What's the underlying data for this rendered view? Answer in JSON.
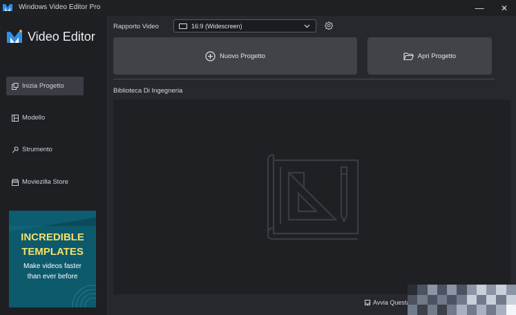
{
  "window": {
    "title": "Windows Video Editor Pro",
    "minimize_glyph": "—",
    "close_glyph": "✕"
  },
  "brand": {
    "name": "Video Editor",
    "logo_icon": "moviezilla-m-logo",
    "accent": "#2f8fe8"
  },
  "sidebar": {
    "items": [
      {
        "label": "Inizia Progetto",
        "icon": "new-project-icon",
        "active": true
      },
      {
        "label": "Modello",
        "icon": "template-icon",
        "active": false
      },
      {
        "label": "Strumento",
        "icon": "tool-icon",
        "active": false
      },
      {
        "label": "Moviezilla Store",
        "icon": "store-icon",
        "active": false
      }
    ]
  },
  "promo": {
    "headline_line1": "INCREDIBLE",
    "headline_line2": "TEMPLATES",
    "sub_line1": "Make videos faster",
    "sub_line2": "than ever before",
    "bg": "#0d5a6d",
    "headline_color": "#f3e06a"
  },
  "toolbar": {
    "ratio_label": "Rapporto Video",
    "ratio_value": "16:9 (Widescreen)"
  },
  "actions": {
    "new_project": "Nuovo Progetto",
    "open_project": "Apri Progetto"
  },
  "library": {
    "label": "Biblioteca Di Ingegneria"
  },
  "footer": {
    "checkbox_label": "Avvia Questa",
    "checked": true
  }
}
